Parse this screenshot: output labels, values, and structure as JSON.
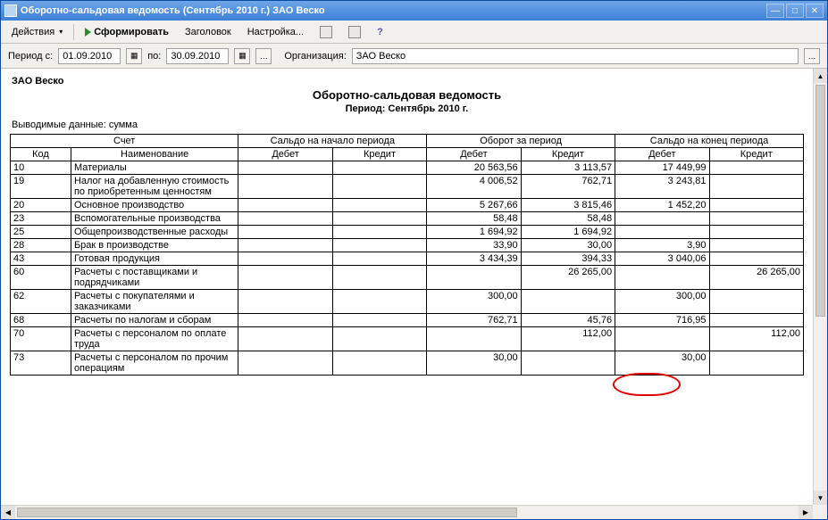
{
  "window": {
    "title": "Оборотно-сальдовая ведомость (Сентябрь 2010 г.) ЗАО Веско"
  },
  "toolbar": {
    "actions": "Действия",
    "form": "Сформировать",
    "header": "Заголовок",
    "settings": "Настройка..."
  },
  "filter": {
    "period_from_label": "Период с:",
    "date_from": "01.09.2010",
    "to_label": "по:",
    "date_to": "30.09.2010",
    "org_label": "Организация:",
    "org_value": "ЗАО Веско"
  },
  "report": {
    "org": "ЗАО Веско",
    "title": "Оборотно-сальдовая ведомость",
    "period": "Период: Сентябрь 2010 г.",
    "subtitle": "Выводимые данные: сумма",
    "columns": {
      "account": "Счет",
      "code": "Код",
      "name": "Наименование",
      "open": "Сальдо на начало периода",
      "turn": "Оборот за период",
      "close": "Сальдо на конец периода",
      "debit": "Дебет",
      "credit": "Кредит"
    },
    "rows": [
      {
        "code": "10",
        "name": "Материалы",
        "od": "",
        "oc": "",
        "td": "20 563,56",
        "tc": "3 113,57",
        "cd": "17 449,99",
        "cc": ""
      },
      {
        "code": "19",
        "name": "Налог на добавленную стоимость по приобретенным ценностям",
        "od": "",
        "oc": "",
        "td": "4 006,52",
        "tc": "762,71",
        "cd": "3 243,81",
        "cc": ""
      },
      {
        "code": "20",
        "name": "Основное производство",
        "od": "",
        "oc": "",
        "td": "5 267,66",
        "tc": "3 815,46",
        "cd": "1 452,20",
        "cc": ""
      },
      {
        "code": "23",
        "name": "Вспомогательные производства",
        "od": "",
        "oc": "",
        "td": "58,48",
        "tc": "58,48",
        "cd": "",
        "cc": ""
      },
      {
        "code": "25",
        "name": "Общепроизводственные расходы",
        "od": "",
        "oc": "",
        "td": "1 694,92",
        "tc": "1 694,92",
        "cd": "",
        "cc": ""
      },
      {
        "code": "28",
        "name": "Брак в производстве",
        "od": "",
        "oc": "",
        "td": "33,90",
        "tc": "30,00",
        "cd": "3,90",
        "cc": ""
      },
      {
        "code": "43",
        "name": "Готовая продукция",
        "od": "",
        "oc": "",
        "td": "3 434,39",
        "tc": "394,33",
        "cd": "3 040,06",
        "cc": ""
      },
      {
        "code": "60",
        "name": "Расчеты с поставщиками и подрядчиками",
        "od": "",
        "oc": "",
        "td": "",
        "tc": "26 265,00",
        "cd": "",
        "cc": "26 265,00"
      },
      {
        "code": "62",
        "name": "Расчеты с покупателями и заказчиками",
        "od": "",
        "oc": "",
        "td": "300,00",
        "tc": "",
        "cd": "300,00",
        "cc": ""
      },
      {
        "code": "68",
        "name": "Расчеты по налогам и сборам",
        "od": "",
        "oc": "",
        "td": "762,71",
        "tc": "45,76",
        "cd": "716,95",
        "cc": ""
      },
      {
        "code": "70",
        "name": "Расчеты с персоналом по оплате труда",
        "od": "",
        "oc": "",
        "td": "",
        "tc": "112,00",
        "cd": "",
        "cc": "112,00"
      },
      {
        "code": "73",
        "name": "Расчеты с персоналом по прочим операциям",
        "od": "",
        "oc": "",
        "td": "30,00",
        "tc": "",
        "cd": "30,00",
        "cc": ""
      }
    ]
  }
}
